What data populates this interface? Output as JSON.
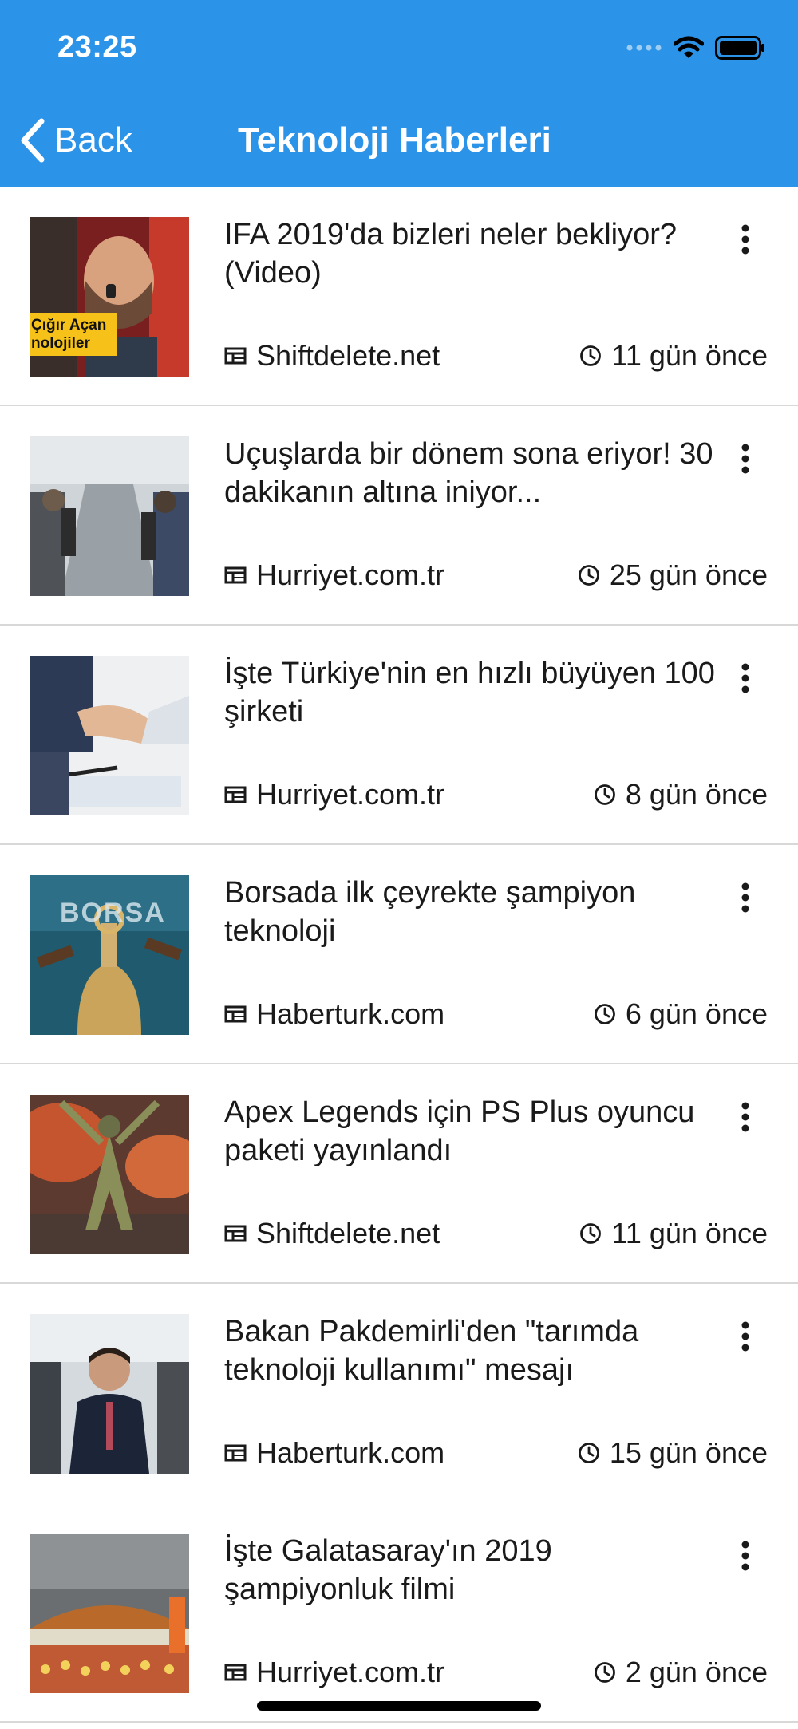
{
  "status_bar": {
    "time": "23:25"
  },
  "nav": {
    "back_label": "Back",
    "title": "Teknoloji Haberleri"
  },
  "colors": {
    "header": "#2b93e8",
    "text": "#1a1a1a",
    "divider": "#d8d8d8"
  },
  "icons": {
    "back": "chevron-left-icon",
    "more": "more-vertical-icon",
    "source": "newspaper-icon",
    "time": "clock-icon"
  },
  "news": [
    {
      "title": "IFA 2019'da bizleri neler bekliyor? (Video)",
      "source": "Shiftdelete.net",
      "time": "11 gün önce",
      "thumb_caption": "Çığır Açan nolojiler"
    },
    {
      "title": "Uçuşlarda bir dönem sona eriyor! 30 dakikanın altına iniyor...",
      "source": "Hurriyet.com.tr",
      "time": "25 gün önce"
    },
    {
      "title": "İşte Türkiye'nin en hızlı büyüyen 100 şirketi",
      "source": "Hurriyet.com.tr",
      "time": "8 gün önce"
    },
    {
      "title": "Borsada ilk çeyrekte şampiyon teknoloji",
      "source": "Haberturk.com",
      "time": "6 gün önce",
      "thumb_caption": "BORSA"
    },
    {
      "title": "Apex Legends için PS Plus oyuncu paketi yayınlandı",
      "source": "Shiftdelete.net",
      "time": "11 gün önce"
    },
    {
      "title": "Bakan Pakdemirli'den \"tarımda teknoloji kullanımı\" mesajı",
      "source": "Haberturk.com",
      "time": "15 gün önce"
    },
    {
      "title": "İşte Galatasaray'ın 2019 şampiyonluk filmi",
      "source": "Hurriyet.com.tr",
      "time": "2 gün önce"
    }
  ]
}
